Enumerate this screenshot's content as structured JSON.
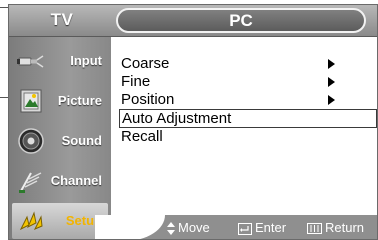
{
  "header": {
    "left_label": "TV",
    "title": "PC"
  },
  "sidebar": {
    "items": [
      {
        "label": "Input",
        "icon": "input-plug-icon",
        "selected": false
      },
      {
        "label": "Picture",
        "icon": "picture-icon",
        "selected": false
      },
      {
        "label": "Sound",
        "icon": "speaker-icon",
        "selected": false
      },
      {
        "label": "Channel",
        "icon": "antenna-icon",
        "selected": false
      },
      {
        "label": "Setup",
        "icon": "setup-icon",
        "selected": true
      }
    ]
  },
  "menu": {
    "items": [
      {
        "label": "Coarse",
        "has_arrow": true,
        "highlighted": false
      },
      {
        "label": "Fine",
        "has_arrow": true,
        "highlighted": false
      },
      {
        "label": "Position",
        "has_arrow": true,
        "highlighted": false
      },
      {
        "label": "Auto Adjustment",
        "has_arrow": false,
        "highlighted": true
      },
      {
        "label": "Recall",
        "has_arrow": false,
        "highlighted": false
      }
    ]
  },
  "footer": {
    "move_label": "Move",
    "enter_label": "Enter",
    "return_label": "Return"
  },
  "colors": {
    "selected_label": "#f2b400",
    "bar_gray": "#8f8f8f"
  }
}
